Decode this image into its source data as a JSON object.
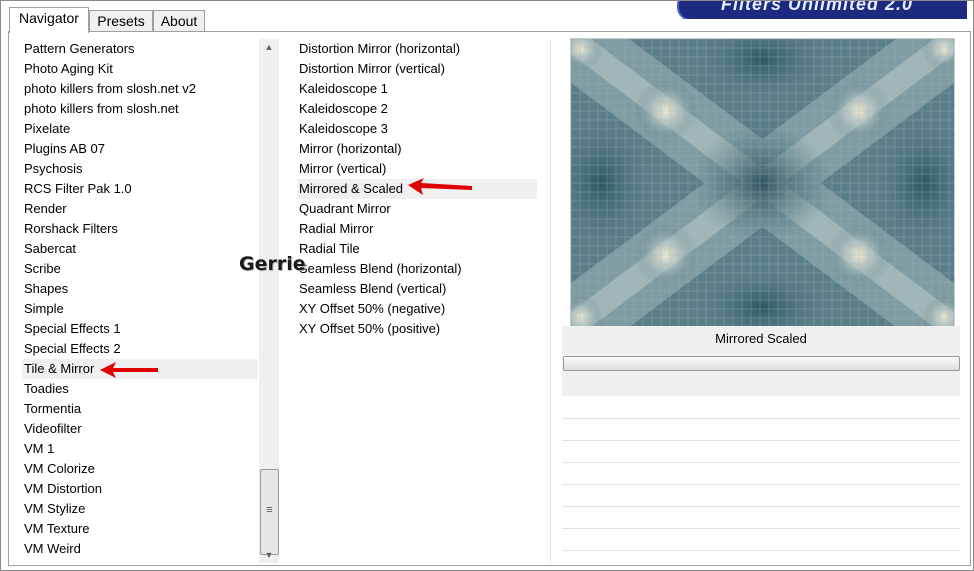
{
  "tabs": [
    {
      "label": "Navigator",
      "active": true
    },
    {
      "label": "Presets",
      "active": false
    },
    {
      "label": "About",
      "active": false
    }
  ],
  "banner": {
    "text": "Filters Unlimited 2.0"
  },
  "categories": {
    "items": [
      "Pattern Generators",
      "Photo Aging Kit",
      "photo killers from slosh.net v2",
      "photo killers from slosh.net",
      "Pixelate",
      "Plugins AB 07",
      "Psychosis",
      "RCS Filter Pak 1.0",
      "Render",
      "Rorshack Filters",
      "Sabercat",
      "Scribe",
      "Shapes",
      "Simple",
      "Special Effects 1",
      "Special Effects 2",
      "Tile & Mirror",
      "Toadies",
      "Tormentia",
      "Videofilter",
      "VM 1",
      "VM Colorize",
      "VM Distortion",
      "VM Stylize",
      "VM Texture",
      "VM Weird"
    ],
    "selected": "Tile & Mirror"
  },
  "filters": {
    "items": [
      "Distortion Mirror (horizontal)",
      "Distortion Mirror (vertical)",
      "Kaleidoscope 1",
      "Kaleidoscope 2",
      "Kaleidoscope 3",
      "Mirror (horizontal)",
      "Mirror (vertical)",
      "Mirrored & Scaled",
      "Quadrant Mirror",
      "Radial Mirror",
      "Radial Tile",
      "Seamless Blend (horizontal)",
      "Seamless Blend (vertical)",
      "XY Offset 50% (negative)",
      "XY Offset 50% (positive)"
    ],
    "selected": "Mirrored & Scaled"
  },
  "preview": {
    "caption": "Mirrored  Scaled"
  },
  "watermark": {
    "text": "Gerrie"
  },
  "colors": {
    "arrow": "#e00000",
    "banner": "#1c2b80",
    "selection": "#f0f0f0"
  }
}
